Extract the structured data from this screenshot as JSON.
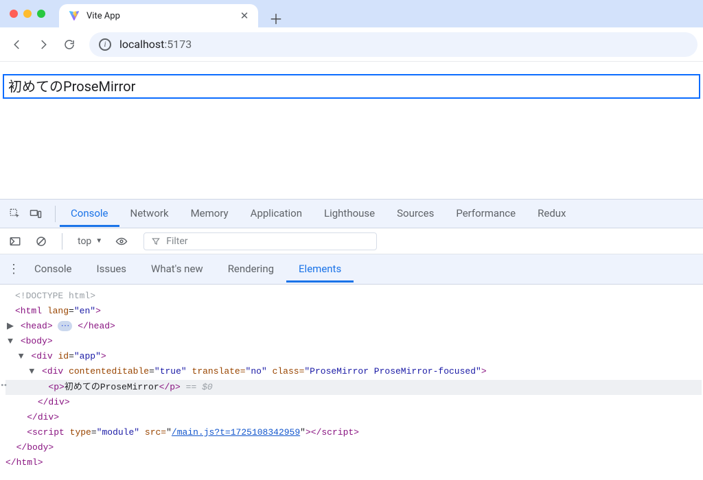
{
  "browser": {
    "tab_title": "Vite App",
    "url_host": "localhost",
    "url_port": ":5173"
  },
  "page": {
    "editor_text": "初めてのProseMirror"
  },
  "devtools": {
    "tabs": [
      "Console",
      "Network",
      "Memory",
      "Application",
      "Lighthouse",
      "Sources",
      "Performance",
      "Redux"
    ],
    "active_tab": "Console",
    "console_ctx": "top",
    "filter_placeholder": "Filter",
    "drawer_tabs": [
      "Console",
      "Issues",
      "What's new",
      "Rendering",
      "Elements"
    ],
    "drawer_active": "Elements"
  },
  "dom": {
    "doctype": "<!DOCTYPE html>",
    "html_open": "<html lang=\"en\">",
    "head_open": "<head>",
    "head_close": "</head>",
    "body_open": "<body>",
    "div_app_open": "<div id=\"app\">",
    "pm_open_1": "<div contenteditable=",
    "pm_val_1": "\"true\"",
    "pm_attr_2": " translate=",
    "pm_val_2": "\"no\"",
    "pm_attr_3": " class=",
    "pm_val_3": "\"ProseMirror ProseMirror-focused\"",
    "pm_open_end": ">",
    "p_text": "初めてのProseMirror",
    "sel_marker": " == $0",
    "div_close": "</div>",
    "script_open": "<script type=",
    "script_type": "\"module\"",
    "script_src_attr": " src=",
    "script_src_val": "/main.js?t=1725108342959",
    "script_close": "></script>",
    "body_close": "</body>",
    "html_close": "</html>"
  }
}
